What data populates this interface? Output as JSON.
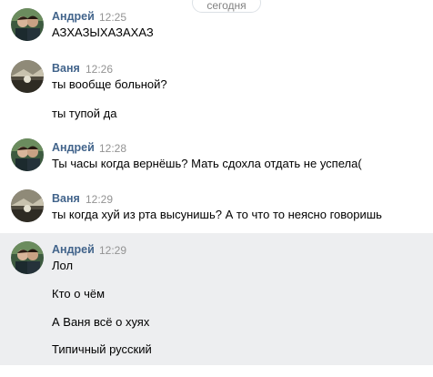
{
  "date_divider": "сегодня",
  "messages": [
    {
      "author": "Андрей",
      "time": "12:25",
      "lines": [
        "АЗХАЗЫХАЗАХАЗ"
      ]
    },
    {
      "author": "Ваня",
      "time": "12:26",
      "lines": [
        "ты вообще больной?",
        "ты тупой да"
      ]
    },
    {
      "author": "Андрей",
      "time": "12:28",
      "lines": [
        "Ты часы когда вернёшь? Мать сдохла отдать не успела("
      ]
    },
    {
      "author": "Ваня",
      "time": "12:29",
      "lines": [
        "ты когда хуй из рта высунишь? А то что то неясно говоришь"
      ]
    },
    {
      "author": "Андрей",
      "time": "12:29",
      "highlighted": true,
      "lines": [
        "Лол",
        "Кто о чём",
        "А Ваня всё о хуях",
        "Типичный русский"
      ]
    }
  ],
  "colors": {
    "author": "#42648b",
    "time": "#939393",
    "highlight_bg": "#edeef0"
  },
  "icons": {
    "andrey_avatar": "user-avatar-andrey",
    "vanya_avatar": "user-avatar-vanya"
  }
}
